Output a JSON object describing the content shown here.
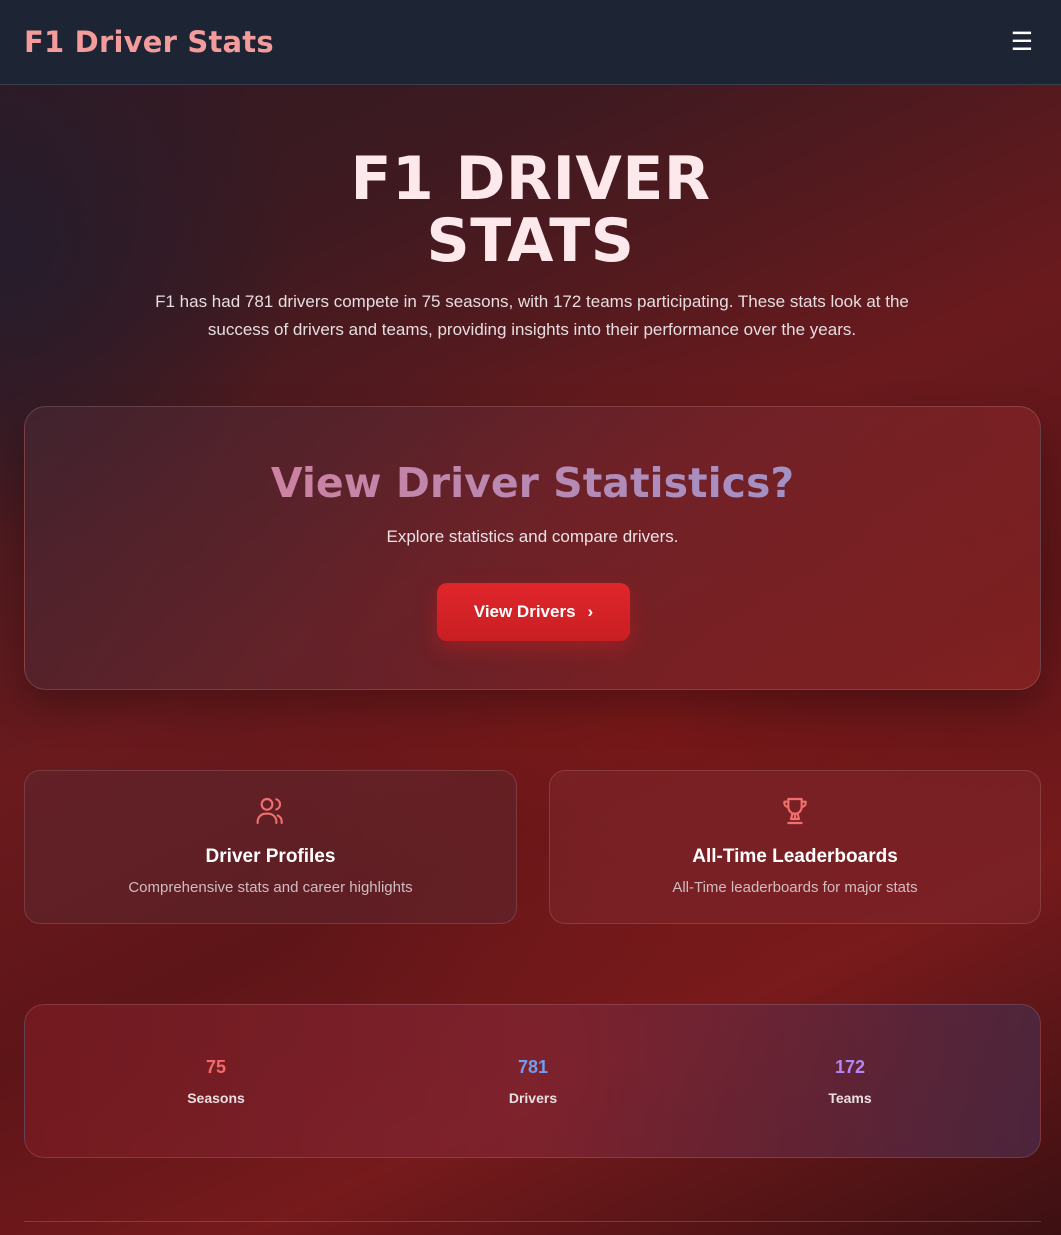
{
  "navbar": {
    "brand": "F1 Driver Stats",
    "menu_icon": "☰"
  },
  "hero": {
    "title_line1": "F1 DRIVER",
    "title_line2": "STATS",
    "description": "F1 has had 781 drivers compete in 75 seasons, with 172 teams participating. These stats look at the success of drivers and teams, providing insights into their performance over the years."
  },
  "cta": {
    "title": "View Driver Statistics?",
    "subtitle": "Explore statistics and compare drivers.",
    "button_label": "View Drivers",
    "button_icon": "›"
  },
  "features": [
    {
      "icon": "users-icon",
      "title": "Driver Profiles",
      "description": "Comprehensive stats and career highlights"
    },
    {
      "icon": "trophy-icon",
      "title": "All-Time Leaderboards",
      "description": "All-Time leaderboards for major stats"
    }
  ],
  "stats": [
    {
      "value": "75",
      "label": "Seasons",
      "color": "#f26a6a"
    },
    {
      "value": "781",
      "label": "Drivers",
      "color": "#6d9ef2"
    },
    {
      "value": "172",
      "label": "Teams",
      "color": "#b388f0"
    }
  ],
  "colors": {
    "navbar_bg": "#1d2433",
    "brand": "#f49b9b",
    "accent_red": "#dc2626",
    "icon": "#f07070"
  }
}
